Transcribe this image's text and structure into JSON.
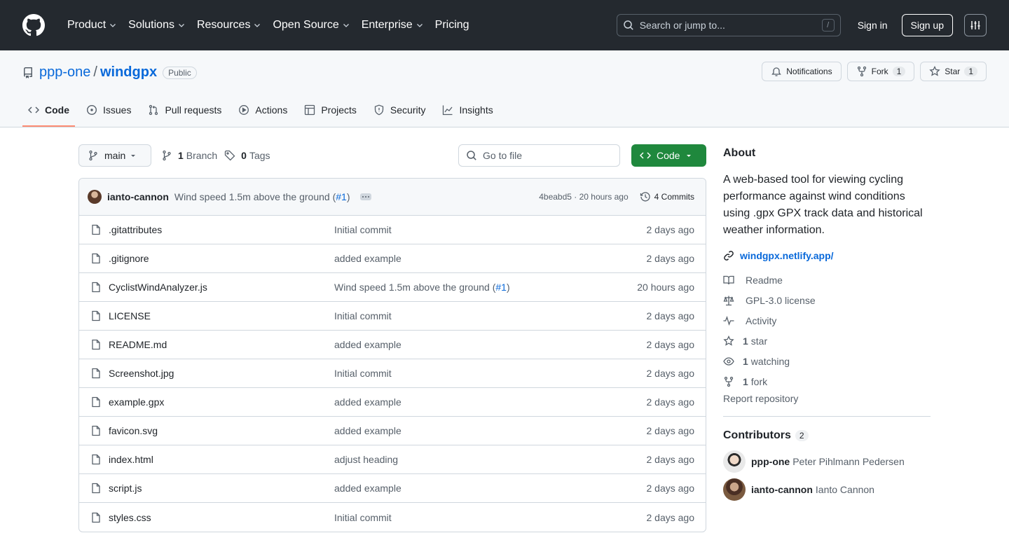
{
  "header": {
    "nav": [
      {
        "label": "Product",
        "dropdown": true
      },
      {
        "label": "Solutions",
        "dropdown": true
      },
      {
        "label": "Resources",
        "dropdown": true
      },
      {
        "label": "Open Source",
        "dropdown": true
      },
      {
        "label": "Enterprise",
        "dropdown": true
      },
      {
        "label": "Pricing",
        "dropdown": false
      }
    ],
    "search_placeholder": "Search or jump to...",
    "search_shortcut": "/",
    "sign_in": "Sign in",
    "sign_up": "Sign up"
  },
  "repo": {
    "owner": "ppp-one",
    "separator": "/",
    "name": "windgpx",
    "visibility": "Public",
    "notifications_label": "Notifications",
    "fork_label": "Fork",
    "fork_count": "1",
    "star_label": "Star",
    "star_count": "1"
  },
  "tabs": [
    {
      "label": "Code",
      "icon": "code-icon",
      "active": true
    },
    {
      "label": "Issues",
      "icon": "issue-icon",
      "active": false
    },
    {
      "label": "Pull requests",
      "icon": "pull-request-icon",
      "active": false
    },
    {
      "label": "Actions",
      "icon": "play-icon",
      "active": false
    },
    {
      "label": "Projects",
      "icon": "table-icon",
      "active": false
    },
    {
      "label": "Security",
      "icon": "shield-icon",
      "active": false
    },
    {
      "label": "Insights",
      "icon": "graph-icon",
      "active": false
    }
  ],
  "toolbar": {
    "branch": "main",
    "branch_count": "1",
    "branch_label": "Branch",
    "tag_count": "0",
    "tag_label": "Tags",
    "goto_placeholder": "Go to file",
    "code_label": "Code"
  },
  "latest_commit": {
    "author": "ianto-cannon",
    "message": "Wind speed 1.5m above the ground (",
    "pr": "#1",
    "message_end": ")",
    "hash_time": "4beabd5 · 20 hours ago",
    "commits_label": "4 Commits"
  },
  "files": [
    {
      "name": ".gitattributes",
      "message": "Initial commit",
      "pr": "",
      "message_end": "",
      "age": "2 days ago"
    },
    {
      "name": ".gitignore",
      "message": "added example",
      "pr": "",
      "message_end": "",
      "age": "2 days ago"
    },
    {
      "name": "CyclistWindAnalyzer.js",
      "message": "Wind speed 1.5m above the ground (",
      "pr": "#1",
      "message_end": ")",
      "age": "20 hours ago"
    },
    {
      "name": "LICENSE",
      "message": "Initial commit",
      "pr": "",
      "message_end": "",
      "age": "2 days ago"
    },
    {
      "name": "README.md",
      "message": "added example",
      "pr": "",
      "message_end": "",
      "age": "2 days ago"
    },
    {
      "name": "Screenshot.jpg",
      "message": "Initial commit",
      "pr": "",
      "message_end": "",
      "age": "2 days ago"
    },
    {
      "name": "example.gpx",
      "message": "added example",
      "pr": "",
      "message_end": "",
      "age": "2 days ago"
    },
    {
      "name": "favicon.svg",
      "message": "added example",
      "pr": "",
      "message_end": "",
      "age": "2 days ago"
    },
    {
      "name": "index.html",
      "message": "adjust heading",
      "pr": "",
      "message_end": "",
      "age": "2 days ago"
    },
    {
      "name": "script.js",
      "message": "added example",
      "pr": "",
      "message_end": "",
      "age": "2 days ago"
    },
    {
      "name": "styles.css",
      "message": "Initial commit",
      "pr": "",
      "message_end": "",
      "age": "2 days ago"
    }
  ],
  "about": {
    "title": "About",
    "description": "A web-based tool for viewing cycling performance against wind conditions using .gpx GPX track data and historical weather information.",
    "website": "windgpx.netlify.app/",
    "items": [
      {
        "icon": "book-icon",
        "bold": "",
        "label": "Readme"
      },
      {
        "icon": "law-icon",
        "bold": "",
        "label": "GPL-3.0 license"
      },
      {
        "icon": "pulse-icon",
        "bold": "",
        "label": "Activity"
      },
      {
        "icon": "star-icon",
        "bold": "1",
        "label": "star"
      },
      {
        "icon": "eye-icon",
        "bold": "1",
        "label": "watching"
      },
      {
        "icon": "fork-icon",
        "bold": "1",
        "label": "fork"
      }
    ],
    "report": "Report repository"
  },
  "contributors": {
    "title": "Contributors",
    "count": "2",
    "list": [
      {
        "login": "ppp-one",
        "name": "Peter Pihlmann Pedersen"
      },
      {
        "login": "ianto-cannon",
        "name": "Ianto Cannon"
      }
    ]
  },
  "colors": {
    "header_bg": "#24292f",
    "link": "#0969da",
    "code_button": "#1f883d",
    "active_tab_underline": "#fd8c73"
  }
}
